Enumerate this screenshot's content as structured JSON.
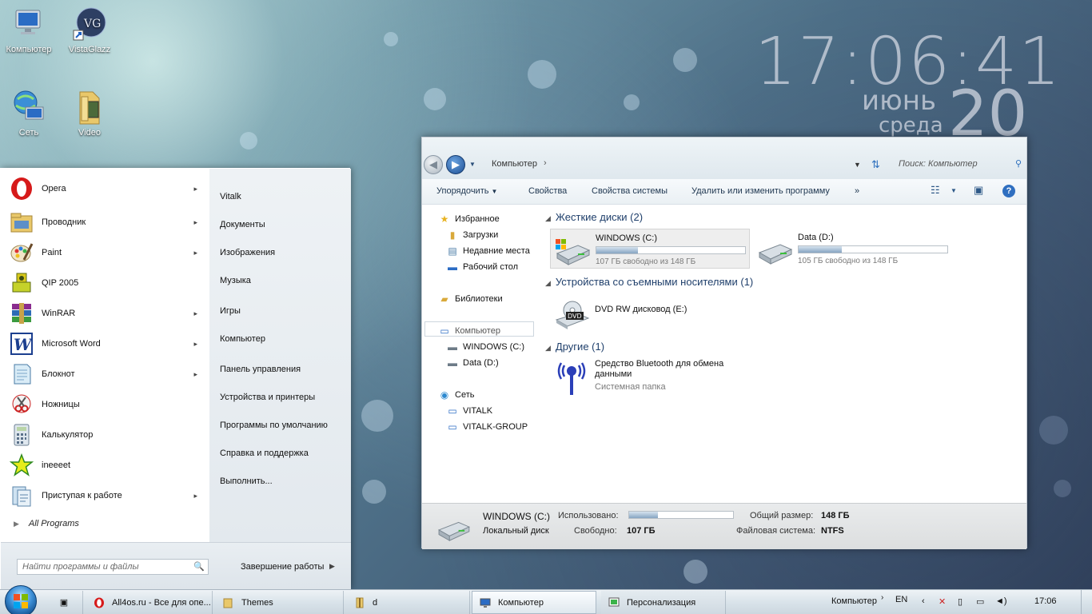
{
  "desktop": {
    "icons": [
      {
        "label": "Компьютер"
      },
      {
        "label": "VistaGlazz"
      },
      {
        "label": "Сеть"
      },
      {
        "label": "Video"
      }
    ],
    "clock": {
      "time": "17:06:41",
      "month": "июнь",
      "weekday": "среда",
      "day": "20"
    }
  },
  "start_menu": {
    "programs": [
      {
        "label": "Opera",
        "has_submenu": true
      },
      {
        "label": "Проводник",
        "has_submenu": true
      },
      {
        "label": "Paint",
        "has_submenu": true
      },
      {
        "label": "QIP 2005",
        "has_submenu": false
      },
      {
        "label": "WinRAR",
        "has_submenu": true
      },
      {
        "label": "Microsoft Word",
        "has_submenu": true
      },
      {
        "label": "Блокнот",
        "has_submenu": true
      },
      {
        "label": "Ножницы",
        "has_submenu": false
      },
      {
        "label": "Калькулятор",
        "has_submenu": false
      },
      {
        "label": "ineeeet",
        "has_submenu": false
      },
      {
        "label": "Приступая к работе",
        "has_submenu": true
      }
    ],
    "all_programs": "All Programs",
    "places": [
      {
        "label": "Vitalk"
      },
      {
        "label": "Документы"
      },
      {
        "label": "Изображения"
      },
      {
        "label": "Музыка"
      },
      {
        "label": "Игры"
      },
      {
        "label": "Компьютер"
      },
      {
        "label": "Панель управления"
      },
      {
        "label": "Устройства и принтеры"
      },
      {
        "label": "Программы по умолчанию"
      },
      {
        "label": "Справка и поддержка"
      },
      {
        "label": "Выполнить..."
      }
    ],
    "search_placeholder": "Найти программы и файлы",
    "shutdown_label": "Завершение работы"
  },
  "explorer": {
    "address": "Компьютер",
    "search_placeholder": "Поиск: Компьютер",
    "toolbar": {
      "organize": "Упорядочить",
      "properties": "Свойства",
      "system_properties": "Свойства системы",
      "uninstall": "Удалить или изменить программу",
      "more": "»"
    },
    "sidebar": {
      "favorites": "Избранное",
      "downloads": "Загрузки",
      "recent": "Недавние места",
      "desktop": "Рабочий стол",
      "libraries": "Библиотеки",
      "computer": "Компьютер",
      "drive_c": "WINDOWS (C:)",
      "drive_d": "Data (D:)",
      "network": "Сеть",
      "net_1": "VITALK",
      "net_2": "VITALK-GROUP"
    },
    "groups": {
      "hard_drives": "Жесткие диски (2)",
      "removable": "Устройства со съемными носителями (1)",
      "other": "Другие (1)"
    },
    "drives": [
      {
        "name": "WINDOWS (C:)",
        "free_text": "107 ГБ свободно из 148 ГБ",
        "used_fraction": 0.28
      },
      {
        "name": "Data (D:)",
        "free_text": "105 ГБ свободно из 148 ГБ",
        "used_fraction": 0.29
      }
    ],
    "dvd": {
      "name": "DVD RW дисковод (E:)",
      "badge": "DVD"
    },
    "bluetooth": {
      "name": "Средство Bluetooth для обмена данными",
      "sub": "Системная папка"
    },
    "details": {
      "name": "WINDOWS (C:)",
      "type": "Локальный диск",
      "used_label": "Использовано:",
      "used_fraction": 0.28,
      "free_label": "Свободно:",
      "free_value": "107 ГБ",
      "total_label": "Общий размер:",
      "total_value": "148 ГБ",
      "fs_label": "Файловая система:",
      "fs_value": "NTFS"
    }
  },
  "taskbar": {
    "buttons": [
      {
        "label": "All4os.ru - Все для опе..."
      },
      {
        "label": "Themes"
      },
      {
        "label": "d"
      },
      {
        "label": "Компьютер"
      },
      {
        "label": "Персонализация"
      }
    ],
    "toolbar_label": "Компьютер",
    "lang": "EN",
    "time": "17:06"
  },
  "colors": {
    "accent": "#2f6fc0",
    "opera_red": "#d61a1a",
    "group_header": "#1f3f6b"
  }
}
